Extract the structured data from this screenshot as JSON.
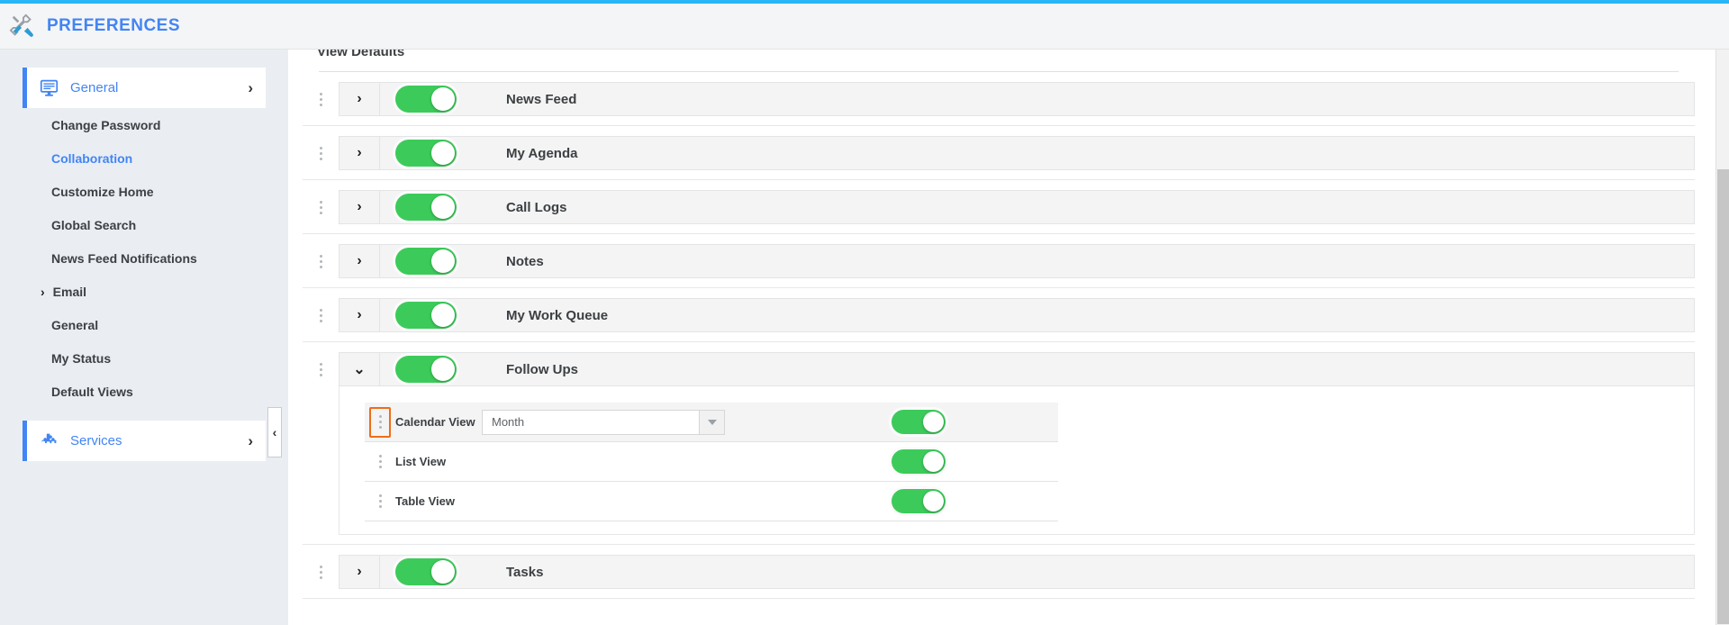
{
  "header": {
    "title": "PREFERENCES",
    "icon": "tools-icon",
    "accent_color": "#4285f4",
    "top_border_color": "#29b6f6"
  },
  "sidebar": {
    "primary": {
      "label": "General",
      "icon": "monitor-icon",
      "chevron": "›",
      "active": true
    },
    "items": [
      {
        "label": "Change Password",
        "active": false
      },
      {
        "label": "Collaboration",
        "active": true
      },
      {
        "label": "Customize Home",
        "active": false
      },
      {
        "label": "Global Search",
        "active": false
      },
      {
        "label": "News Feed Notifications",
        "active": false
      }
    ],
    "group": {
      "label": "Email",
      "chevron": "›"
    },
    "group_items": [
      {
        "label": "General",
        "active": false
      },
      {
        "label": "My Status",
        "active": false
      },
      {
        "label": "Default Views",
        "active": false
      }
    ],
    "secondary": {
      "label": "Services",
      "icon": "puzzle-icon",
      "chevron": "›",
      "active": true
    },
    "collapse_handle": {
      "icon": "chevron-left-icon",
      "glyph": "‹"
    }
  },
  "main": {
    "section_title": "View Defaults",
    "rows": [
      {
        "label": "News Feed",
        "expanded": false,
        "enabled": true,
        "chevron": "›"
      },
      {
        "label": "My Agenda",
        "expanded": false,
        "enabled": true,
        "chevron": "›"
      },
      {
        "label": "Call Logs",
        "expanded": false,
        "enabled": true,
        "chevron": "›"
      },
      {
        "label": "Notes",
        "expanded": false,
        "enabled": true,
        "chevron": "›"
      },
      {
        "label": "My Work Queue",
        "expanded": false,
        "enabled": true,
        "chevron": "›"
      },
      {
        "label": "Follow Ups",
        "expanded": true,
        "enabled": true,
        "chevron": "⌄"
      },
      {
        "label": "Tasks",
        "expanded": false,
        "enabled": true,
        "chevron": "›"
      }
    ],
    "follow_ups_subrows": [
      {
        "label": "Calendar View",
        "enabled": true,
        "has_select": true,
        "select_value": "Month",
        "handle_highlighted": true
      },
      {
        "label": "List View",
        "enabled": true,
        "has_select": false,
        "select_value": "",
        "handle_highlighted": false
      },
      {
        "label": "Table View",
        "enabled": true,
        "has_select": false,
        "select_value": "",
        "handle_highlighted": false
      }
    ],
    "toggle_on_color": "#3ccb5a",
    "highlight_color": "#ef6c18"
  }
}
